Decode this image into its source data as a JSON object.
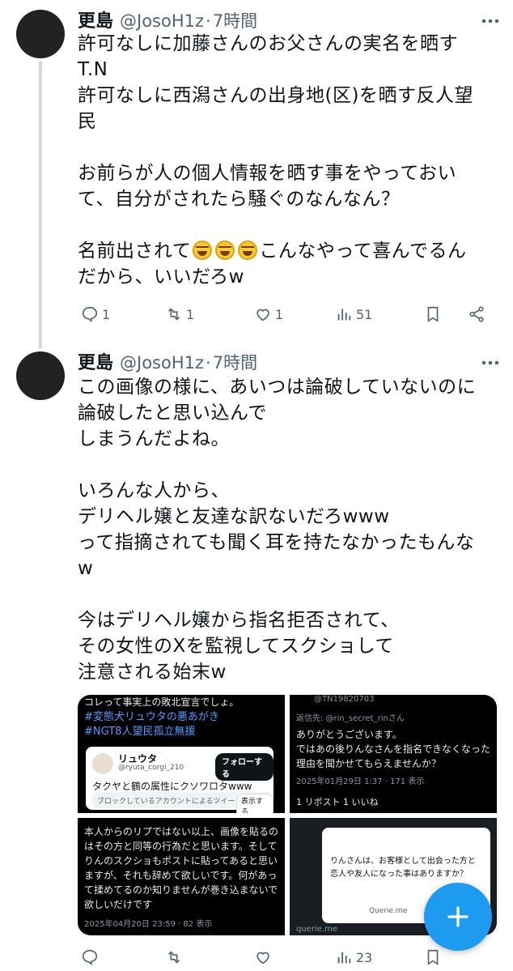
{
  "tweets": [
    {
      "display_name": "更島",
      "handle": "@JosoH1z",
      "separator": "·",
      "time": "7時間",
      "lines": [
        "許可なしに加藤さんのお父さんの実名を晒す",
        "T.N",
        "許可なしに西潟さんの出身地(区)を晒す反人望",
        "民",
        "",
        "お前らが人の個人情報を晒す事をやっておい",
        "て、自分がされたら騒ぐのなんなん？",
        ""
      ],
      "emoji_line_before": "名前出されて",
      "emoji_line_after": "こんなやって喜んでる",
      "emoji_name": "rolling-on-floor-laughing-emoji",
      "last_line_tail": "ん",
      "last_line": "だから、いいだろw",
      "actions": {
        "reply_count": "1",
        "retweet_count": "1",
        "like_count": "1",
        "view_count": "51"
      }
    },
    {
      "display_name": "更島",
      "handle": "@JosoH1z",
      "separator": "·",
      "time": "7時間",
      "lines": [
        "この画像の様に、あいつは論破していないのに",
        "論破したと思い込んで",
        "しまうんだよね。",
        "",
        "いろんな人から、",
        "デリヘル嬢と友達な訳ないだろwww",
        "って指摘されても聞く耳を持たなかったもんな",
        "w",
        "",
        "今はデリヘル嬢から指名拒否されて、",
        "その女性のXを監視してスクショして",
        "注意される始末w"
      ],
      "media": {
        "tile1": {
          "top_line": "コレって事実上の敗北宣言でしょ。",
          "tag1": "#変態犬リュウタの悪あがき",
          "tag2": "#NGT8人望民孤立無援",
          "quote_name": "リュウタ",
          "quote_handle": "@ryuta_corgi_210",
          "follow_label": "フォローする",
          "quote_text": "タクヤと鶴の属性にクソワロタwww",
          "blocked_text": "ブロックしているアカウントによるツイートです。",
          "show_label": "表示する"
        },
        "tile2": {
          "handle": "@TN19820703",
          "reply_to": "返信先: @rin_secret_rinさん",
          "line1": "ありがとうございます。",
          "line2": "ではあの後りんなさんを指名できなくなった",
          "line3": "理由を聞かせてもらえませんか？",
          "meta": "2025年01月29日 1:37 · 171 表示",
          "stats": "1 リポスト  1 いいね"
        },
        "tile3": {
          "line1": "本人からのリプではない以上、画像を貼るの",
          "line2": "はその方と同等の行為だと思います。そして",
          "line3": "りんのスクショもポストに貼ってあると思い",
          "line4": "ますが、それも辞めて欲しいです。何があっ",
          "line5": "て揉めてるのか知りませんが巻き込まないで",
          "line6": "欲しいだけです",
          "meta": "2025年04月20日 23:59 · 82 表示"
        },
        "tile4": {
          "dialog_line1": "りんさんは、お客様として出会った方と",
          "dialog_line2": "恋人や友人になった事はありますか？",
          "dialog_brand": "Querie.me",
          "footer": "querie.me"
        }
      },
      "actions": {
        "reply_count": "",
        "retweet_count": "",
        "like_count": "",
        "view_count": "23"
      }
    }
  ],
  "fab": {
    "icon": "plus-icon",
    "color": "#1d9bf0"
  },
  "colors": {
    "text": "#0f1419",
    "secondary": "#536471",
    "accent": "#1d9bf0"
  }
}
